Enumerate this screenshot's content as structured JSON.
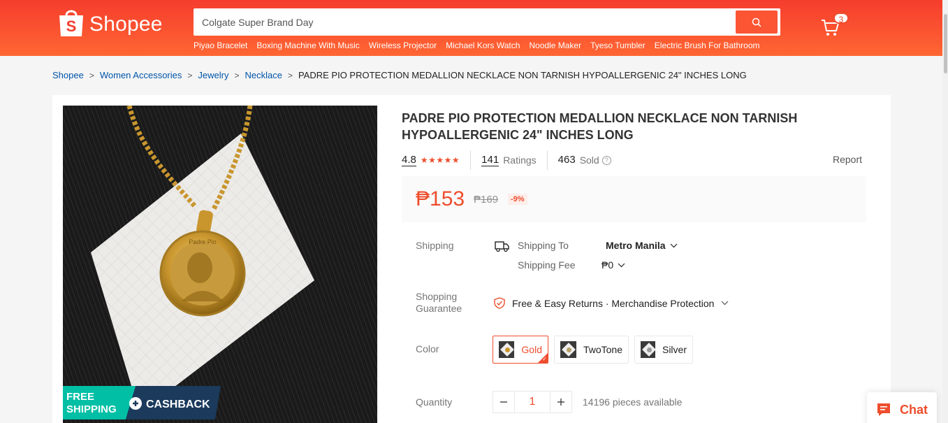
{
  "header": {
    "logo_text": "Shopee",
    "search_value": "Colgate Super Brand Day",
    "cart_count": "3",
    "keywords": [
      "Piyao Bracelet",
      "Boxing Machine With Music",
      "Wireless Projector",
      "Michael Kors Watch",
      "Noodle Maker",
      "Tyeso Tumbler",
      "Electric Brush For Bathroom"
    ]
  },
  "breadcrumb": {
    "items": [
      "Shopee",
      "Women Accessories",
      "Jewelry",
      "Necklace"
    ],
    "current": "PADRE PIO PROTECTION MEDALLION NECKLACE NON TARNISH HYPOALLERGENIC 24\" INCHES LONG"
  },
  "product": {
    "title": "PADRE PIO PROTECTION MEDALLION NECKLACE NON TARNISH HYPOALLERGENIC 24\" INCHES LONG",
    "rating": "4.8",
    "stars": "★★★★★",
    "ratings_count": "141",
    "ratings_label": "Ratings",
    "sold_count": "463",
    "sold_label": "Sold",
    "report_label": "Report",
    "price": "₱153",
    "original_price": "₱169",
    "discount": "-9%",
    "promo_free": "FREE",
    "promo_shipping": "SHIPPING",
    "promo_cashback": "CASHBACK",
    "medallion_text": "Padre Pio"
  },
  "shipping": {
    "label": "Shipping",
    "to_label": "Shipping To",
    "to_value": "Metro Manila",
    "fee_label": "Shipping Fee",
    "fee_value": "₱0"
  },
  "guarantee": {
    "label_line1": "Shopping",
    "label_line2": "Guarantee",
    "text": "Free & Easy Returns · Merchandise Protection"
  },
  "color": {
    "label": "Color",
    "options": [
      "Gold",
      "TwoTone",
      "Silver"
    ],
    "selected": "Gold"
  },
  "quantity": {
    "label": "Quantity",
    "value": "1",
    "available": "14196 pieces available"
  },
  "chat": {
    "label": "Chat"
  },
  "colors": {
    "brand": "#ee4d2d",
    "header_start": "#f53d2d",
    "header_end": "#ff6633"
  }
}
